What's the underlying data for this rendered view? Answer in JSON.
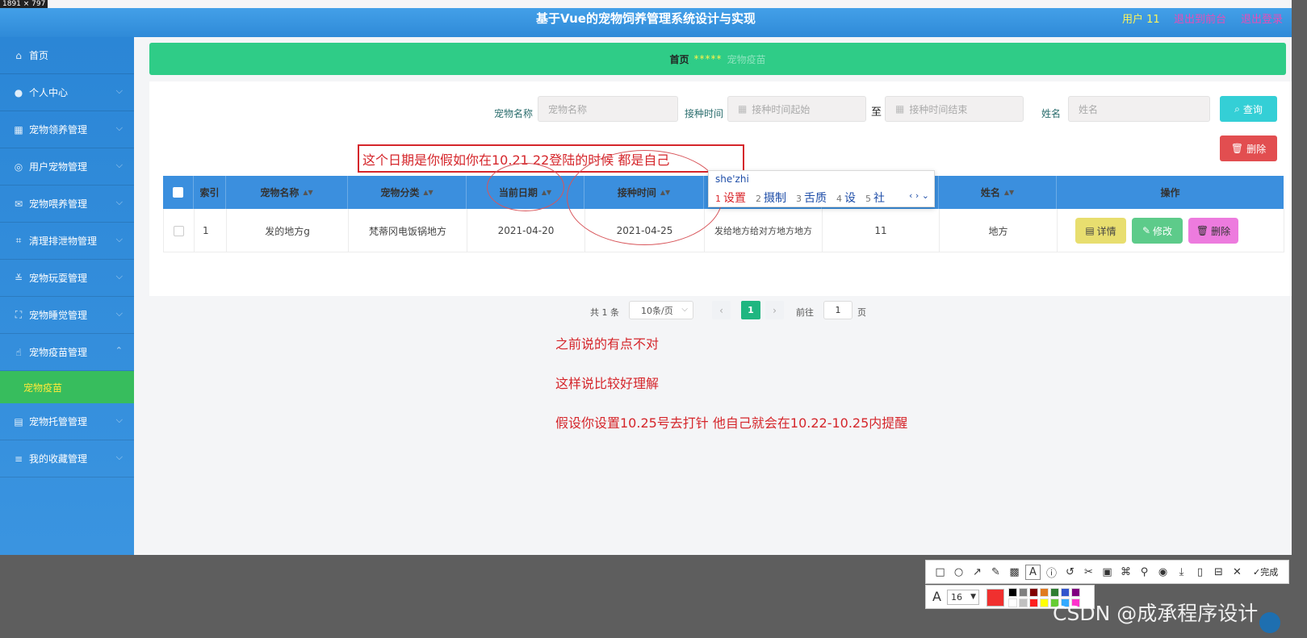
{
  "screen_size_label": "1891 × 797",
  "header": {
    "title": "基于Vue的宠物饲养管理系统设计与实现",
    "user": "用户 11",
    "front": "退出到前台",
    "logout": "退出登录"
  },
  "sidebar": {
    "items": [
      {
        "label": "首页",
        "icon": "home-icon",
        "glyph": "⌂",
        "has_children": false
      },
      {
        "label": "个人中心",
        "icon": "user-icon",
        "glyph": "●",
        "has_children": true
      },
      {
        "label": "宠物领养管理",
        "icon": "grid-icon",
        "glyph": "▦",
        "has_children": true
      },
      {
        "label": "用户宠物管理",
        "icon": "settings-icon",
        "glyph": "◎",
        "has_children": true
      },
      {
        "label": "宠物喂养管理",
        "icon": "mail-icon",
        "glyph": "✉",
        "has_children": true
      },
      {
        "label": "清理排泄物管理",
        "icon": "crop-icon",
        "glyph": "⌗",
        "has_children": true
      },
      {
        "label": "宠物玩耍管理",
        "icon": "sliders-icon",
        "glyph": "≚",
        "has_children": true
      },
      {
        "label": "宠物睡觉管理",
        "icon": "fullscreen-icon",
        "glyph": "⛶",
        "has_children": true
      },
      {
        "label": "宠物疫苗管理",
        "icon": "thumb-icon",
        "glyph": "☝",
        "has_children": true,
        "expanded": true,
        "sub": "宠物疫苗"
      },
      {
        "label": "宠物托管管理",
        "icon": "printer-icon",
        "glyph": "▤",
        "has_children": true
      },
      {
        "label": "我的收藏管理",
        "icon": "menu-icon",
        "glyph": "≡",
        "has_children": true
      }
    ]
  },
  "breadcrumb": {
    "home": "首页",
    "separator": "*****",
    "current": "宠物疫苗"
  },
  "search": {
    "name_label": "宠物名称",
    "name_placeholder": "宠物名称",
    "time_label": "接种时间",
    "time_start_placeholder": "接种时间起始",
    "to": "至",
    "time_end_placeholder": "接种时间结束",
    "person_label": "姓名",
    "person_placeholder": "姓名",
    "query_button": "查询",
    "delete_button": "删除"
  },
  "table": {
    "headers": [
      "索引",
      "宠物名称",
      "宠物分类",
      "当前日期",
      "接种时间",
      "",
      "",
      "姓名",
      "操作"
    ],
    "rows": [
      {
        "index": "1",
        "name": "发的地方g",
        "category": "梵蒂冈电饭锅地方",
        "current_date": "2021-04-20",
        "vaccine_time": "2021-04-25",
        "remark": "发给地方给对方地方地方",
        "account": "11",
        "person": "地方"
      }
    ],
    "actions": {
      "detail": "详情",
      "edit": "修改",
      "delete": "删除"
    }
  },
  "pager": {
    "total": "共 1 条",
    "page_size": "10条/页",
    "current": "1",
    "goto": "前往",
    "goto_value": "1",
    "page_unit": "页"
  },
  "annotations": {
    "box_text": "这个日期是你假如你在10.21  22登陆的时候  都是自己",
    "line1": "之前说的有点不对",
    "line2": "这样说比较好理解",
    "line3": "假设你设置10.25号去打针    他自己就会在10.22-10.25内提醒"
  },
  "ime": {
    "composition": "she'zhi",
    "candidates": [
      {
        "n": "1",
        "text": "设置"
      },
      {
        "n": "2",
        "text": "摄制"
      },
      {
        "n": "3",
        "text": "舌质"
      },
      {
        "n": "4",
        "text": "设"
      },
      {
        "n": "5",
        "text": "社"
      }
    ],
    "nav": "‹ › ⌄"
  },
  "screenshot_tool": {
    "done": "完成",
    "font_size": "16",
    "current_color": "#f0302f",
    "palette": [
      "#000000",
      "#808080",
      "#800000",
      "#e07a20",
      "#2f7d32",
      "#3355cc",
      "#800080",
      "#ffffff",
      "#c0c0c0",
      "#ff2020",
      "#ffff00",
      "#66cc33",
      "#33aaff",
      "#ff33cc"
    ]
  },
  "watermark": "CSDN @成承程序设计",
  "colors": {
    "header_bg": "#3a96e2",
    "sidebar_bg": "#2b86d6",
    "breadcrumb_bg": "#2fcc87",
    "active_sub_bg": "#37bd5d",
    "table_header_bg": "#3b8fde",
    "annotation_red": "#d5262b"
  }
}
